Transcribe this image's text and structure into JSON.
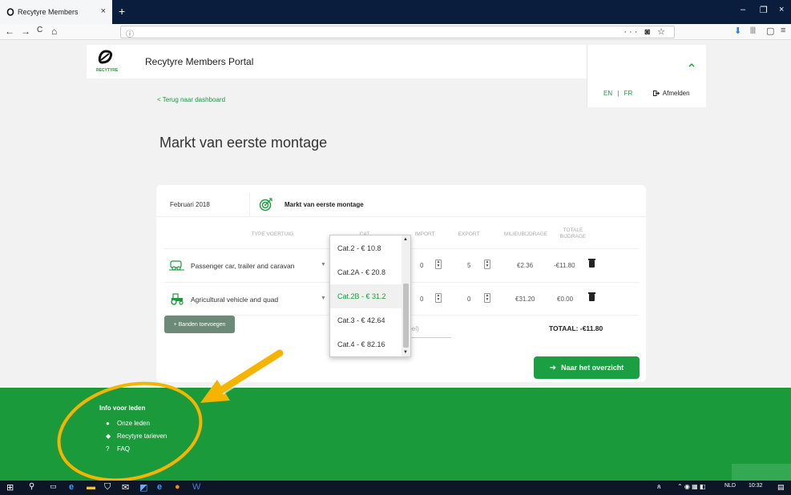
{
  "browser": {
    "tab_title": "Recytyre Members",
    "tab_close": "×",
    "new_tab": "+",
    "window_controls": [
      "–",
      "❐",
      "×"
    ],
    "nav": [
      "←",
      "→",
      "C",
      "⌂"
    ],
    "url_info": "ⓘ",
    "url_actions": "··· ◙ ☆",
    "toolbar": [
      "⬇",
      "|||",
      "▢",
      "≡"
    ]
  },
  "header": {
    "logo_text": "RECYTYRE",
    "portal_title": "Recytyre Members Portal",
    "lang_en": "EN",
    "lang_sep": "|",
    "lang_fr": "FR",
    "logout": "Afmelden"
  },
  "back_link": "< Terug naar dashboard",
  "page_title": "Markt van eerste montage",
  "card": {
    "period": "Februari 2018",
    "market_name": "Markt van eerste montage",
    "columns": {
      "type": "TYPE VOERTUIG",
      "cat": "CAT",
      "import": "IMPORT",
      "export": "EXPORT",
      "milieubijdrage": "MILIEUBIJDRAGE",
      "totale_line1": "TOTALE",
      "totale_line2": "BIJDRAGE"
    },
    "rows": [
      {
        "vehicle": "Passenger car, trailer and caravan",
        "import": "0",
        "export": "5",
        "milieu": "€2.36",
        "totaal": "-€11.80"
      },
      {
        "vehicle": "Agricultural vehicle and quad",
        "import": "0",
        "export": "0",
        "milieu": "€31.20",
        "totaal": "€0.00"
      }
    ],
    "add_button": "+ Banden toevoegen",
    "partial_field": "neel)",
    "total": "TOTAAL: -€11.80",
    "cta": "Naar het overzicht"
  },
  "dropdown": {
    "options": [
      "Cat.2 - € 10.8",
      "Cat.2A - € 20.8",
      "Cat.2B - € 31.2",
      "Cat.3 - € 42.64",
      "Cat.4 - € 82.16"
    ],
    "selected": "Cat.2B - € 31.2"
  },
  "footer": {
    "title": "Info voor leden",
    "links": [
      "Onze leden",
      "Recytyre tarieven",
      "FAQ"
    ]
  },
  "taskbar": {
    "lang": "NLD",
    "time": "10:32"
  },
  "colors": {
    "brand_green": "#1a9a3b",
    "annotation_yellow": "#f5b400"
  }
}
